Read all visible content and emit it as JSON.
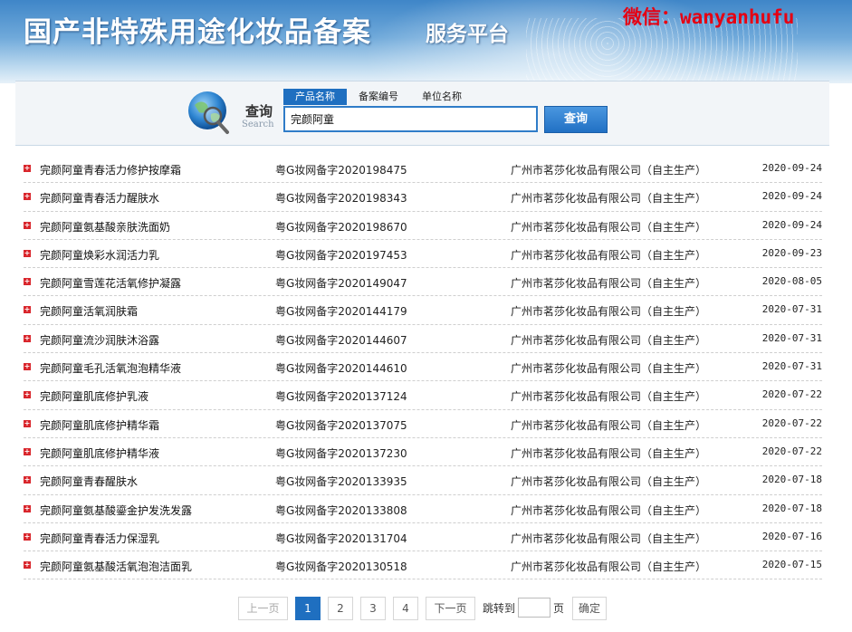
{
  "banner": {
    "title": "国产非特殊用途化妆品备案",
    "subtitle": "服务平台",
    "watermark": "微信：wanyanhufu"
  },
  "search": {
    "label": "查询",
    "label_en": "Search",
    "tabs": [
      {
        "label": "产品名称",
        "active": true
      },
      {
        "label": "备案编号",
        "active": false
      },
      {
        "label": "单位名称",
        "active": false
      }
    ],
    "query": "完颜阿童",
    "button_label": "查询"
  },
  "results": [
    {
      "name": "完颜阿童青春活力修护按摩霜",
      "code": "粤G妆网备字2020198475",
      "company": "广州市茗莎化妆品有限公司（自主生产）",
      "date": "2020-09-24"
    },
    {
      "name": "完颜阿童青春活力醒肤水",
      "code": "粤G妆网备字2020198343",
      "company": "广州市茗莎化妆品有限公司（自主生产）",
      "date": "2020-09-24"
    },
    {
      "name": "完颜阿童氨基酸亲肤洗面奶",
      "code": "粤G妆网备字2020198670",
      "company": "广州市茗莎化妆品有限公司（自主生产）",
      "date": "2020-09-24"
    },
    {
      "name": "完颜阿童焕彩水润活力乳",
      "code": "粤G妆网备字2020197453",
      "company": "广州市茗莎化妆品有限公司（自主生产）",
      "date": "2020-09-23"
    },
    {
      "name": "完颜阿童雪莲花活氧修护凝露",
      "code": "粤G妆网备字2020149047",
      "company": "广州市茗莎化妆品有限公司（自主生产）",
      "date": "2020-08-05"
    },
    {
      "name": "完颜阿童活氧润肤霜",
      "code": "粤G妆网备字2020144179",
      "company": "广州市茗莎化妆品有限公司（自主生产）",
      "date": "2020-07-31"
    },
    {
      "name": "完颜阿童流沙润肤沐浴露",
      "code": "粤G妆网备字2020144607",
      "company": "广州市茗莎化妆品有限公司（自主生产）",
      "date": "2020-07-31"
    },
    {
      "name": "完颜阿童毛孔活氧泡泡精华液",
      "code": "粤G妆网备字2020144610",
      "company": "广州市茗莎化妆品有限公司（自主生产）",
      "date": "2020-07-31"
    },
    {
      "name": "完颜阿童肌底修护乳液",
      "code": "粤G妆网备字2020137124",
      "company": "广州市茗莎化妆品有限公司（自主生产）",
      "date": "2020-07-22"
    },
    {
      "name": "完颜阿童肌底修护精华霜",
      "code": "粤G妆网备字2020137075",
      "company": "广州市茗莎化妆品有限公司（自主生产）",
      "date": "2020-07-22"
    },
    {
      "name": "完颜阿童肌底修护精华液",
      "code": "粤G妆网备字2020137230",
      "company": "广州市茗莎化妆品有限公司（自主生产）",
      "date": "2020-07-22"
    },
    {
      "name": "完颜阿童青春醒肤水",
      "code": "粤G妆网备字2020133935",
      "company": "广州市茗莎化妆品有限公司（自主生产）",
      "date": "2020-07-18"
    },
    {
      "name": "完颜阿童氨基酸鎏金护发洗发露",
      "code": "粤G妆网备字2020133808",
      "company": "广州市茗莎化妆品有限公司（自主生产）",
      "date": "2020-07-18"
    },
    {
      "name": "完颜阿童青春活力保湿乳",
      "code": "粤G妆网备字2020131704",
      "company": "广州市茗莎化妆品有限公司（自主生产）",
      "date": "2020-07-16"
    },
    {
      "name": "完颜阿童氨基酸活氧泡泡洁面乳",
      "code": "粤G妆网备字2020130518",
      "company": "广州市茗莎化妆品有限公司（自主生产）",
      "date": "2020-07-15"
    }
  ],
  "pagination": {
    "prev_label": "上一页",
    "pages": [
      "1",
      "2",
      "3",
      "4"
    ],
    "current_page": "1",
    "next_label": "下一页",
    "jump_label": "跳转到",
    "page_unit": "页",
    "jump_value": "",
    "confirm_label": "确定"
  },
  "colors": {
    "accent": "#1f6fc0",
    "bullet": "#d9262c",
    "watermark": "#e60012"
  }
}
